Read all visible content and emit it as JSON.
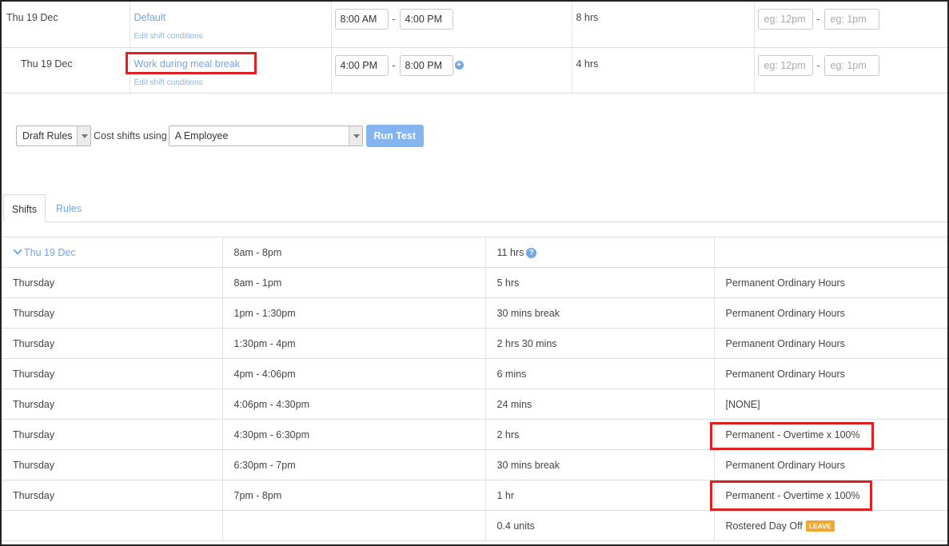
{
  "shifts": [
    {
      "date": "Thu 19 Dec",
      "name": "Default",
      "edit_label": "Edit shift conditions",
      "start": "8:00 AM",
      "end": "4:00 PM",
      "hours": "8 hrs",
      "break_start_placeholder": "eg: 12pm",
      "break_end_placeholder": "eg: 1pm"
    },
    {
      "date": "Thu 19 Dec",
      "name": "Work during meal break",
      "edit_label": "Edit shift conditions",
      "start": "4:00 PM",
      "end": "8:00 PM",
      "hours": "4 hrs",
      "break_start_placeholder": "eg: 12pm",
      "break_end_placeholder": "eg: 1pm"
    }
  ],
  "time_separator": "-",
  "controls": {
    "rules_select": "Draft Rules",
    "cost_label": "Cost shifts using",
    "employee_select": "A Employee",
    "run_button": "Run Test"
  },
  "tabs": {
    "shifts": "Shifts",
    "rules": "Rules"
  },
  "results": {
    "header": {
      "date": "Thu 19 Dec",
      "range": "8am - 8pm",
      "hours": "11 hrs",
      "category": ""
    },
    "rows": [
      {
        "day": "Thursday",
        "range": "8am - 1pm",
        "duration": "5 hrs",
        "category": "Permanent Ordinary Hours"
      },
      {
        "day": "Thursday",
        "range": "1pm - 1:30pm",
        "duration": "30 mins break",
        "category": "Permanent Ordinary Hours"
      },
      {
        "day": "Thursday",
        "range": "1:30pm - 4pm",
        "duration": "2 hrs 30 mins",
        "category": "Permanent Ordinary Hours"
      },
      {
        "day": "Thursday",
        "range": "4pm - 4:06pm",
        "duration": "6 mins",
        "category": "Permanent Ordinary Hours"
      },
      {
        "day": "Thursday",
        "range": "4:06pm - 4:30pm",
        "duration": "24 mins",
        "category": "[NONE]"
      },
      {
        "day": "Thursday",
        "range": "4:30pm - 6:30pm",
        "duration": "2 hrs",
        "category": "Permanent - Overtime x 100%"
      },
      {
        "day": "Thursday",
        "range": "6:30pm - 7pm",
        "duration": "30 mins break",
        "category": "Permanent Ordinary Hours"
      },
      {
        "day": "Thursday",
        "range": "7pm - 8pm",
        "duration": "1 hr",
        "category": "Permanent - Overtime x 100%"
      }
    ],
    "footer": {
      "units": "0.4 units",
      "category": "Rostered Day Off",
      "badge": "LEAVE"
    }
  },
  "colors": {
    "link": "#6fa6e6",
    "highlight": "#e02020",
    "run_button": "#85b5f1",
    "leave_badge": "#f0a830"
  }
}
